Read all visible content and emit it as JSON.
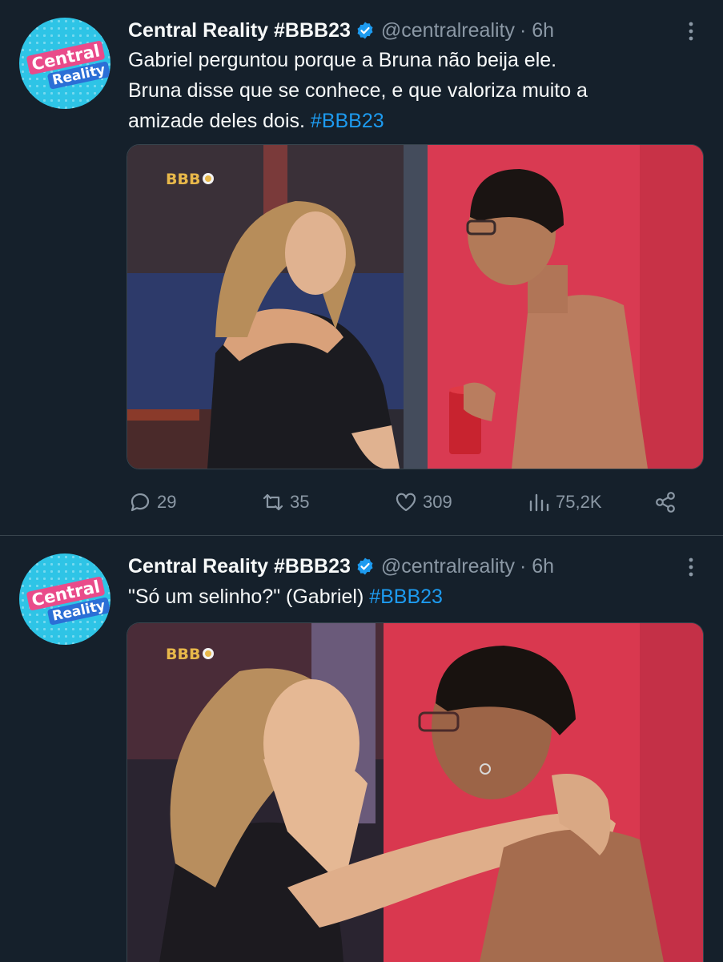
{
  "tweets": [
    {
      "author": "Central Reality #BBB23",
      "handle": "@centralreality",
      "time": "· 6h",
      "avatar_text_1": "Central",
      "avatar_text_2": "Reality",
      "text_1": "Gabriel perguntou porque a Bruna não beija ele.",
      "text_2": "Bruna disse que se conhece, e que valoriza muito a",
      "text_3": "amizade deles dois.",
      "hashtag": "#BBB23",
      "media_logo": "BBB",
      "replies": "29",
      "retweets": "35",
      "likes": "309",
      "views": "75,2K"
    },
    {
      "author": "Central Reality #BBB23",
      "handle": "@centralreality",
      "time": "· 6h",
      "avatar_text_1": "Central",
      "avatar_text_2": "Reality",
      "text_1": "\"Só um selinho?\" (Gabriel)",
      "hashtag": "#BBB23",
      "media_logo": "BBB"
    }
  ],
  "colors": {
    "background": "#15202b",
    "text": "#f7f9f9",
    "secondary": "#8b98a5",
    "accent": "#1d9bf0",
    "divider": "#38444d"
  },
  "icons": [
    "verified-badge-icon",
    "more-icon",
    "reply-icon",
    "retweet-icon",
    "like-icon",
    "views-icon",
    "share-icon"
  ]
}
